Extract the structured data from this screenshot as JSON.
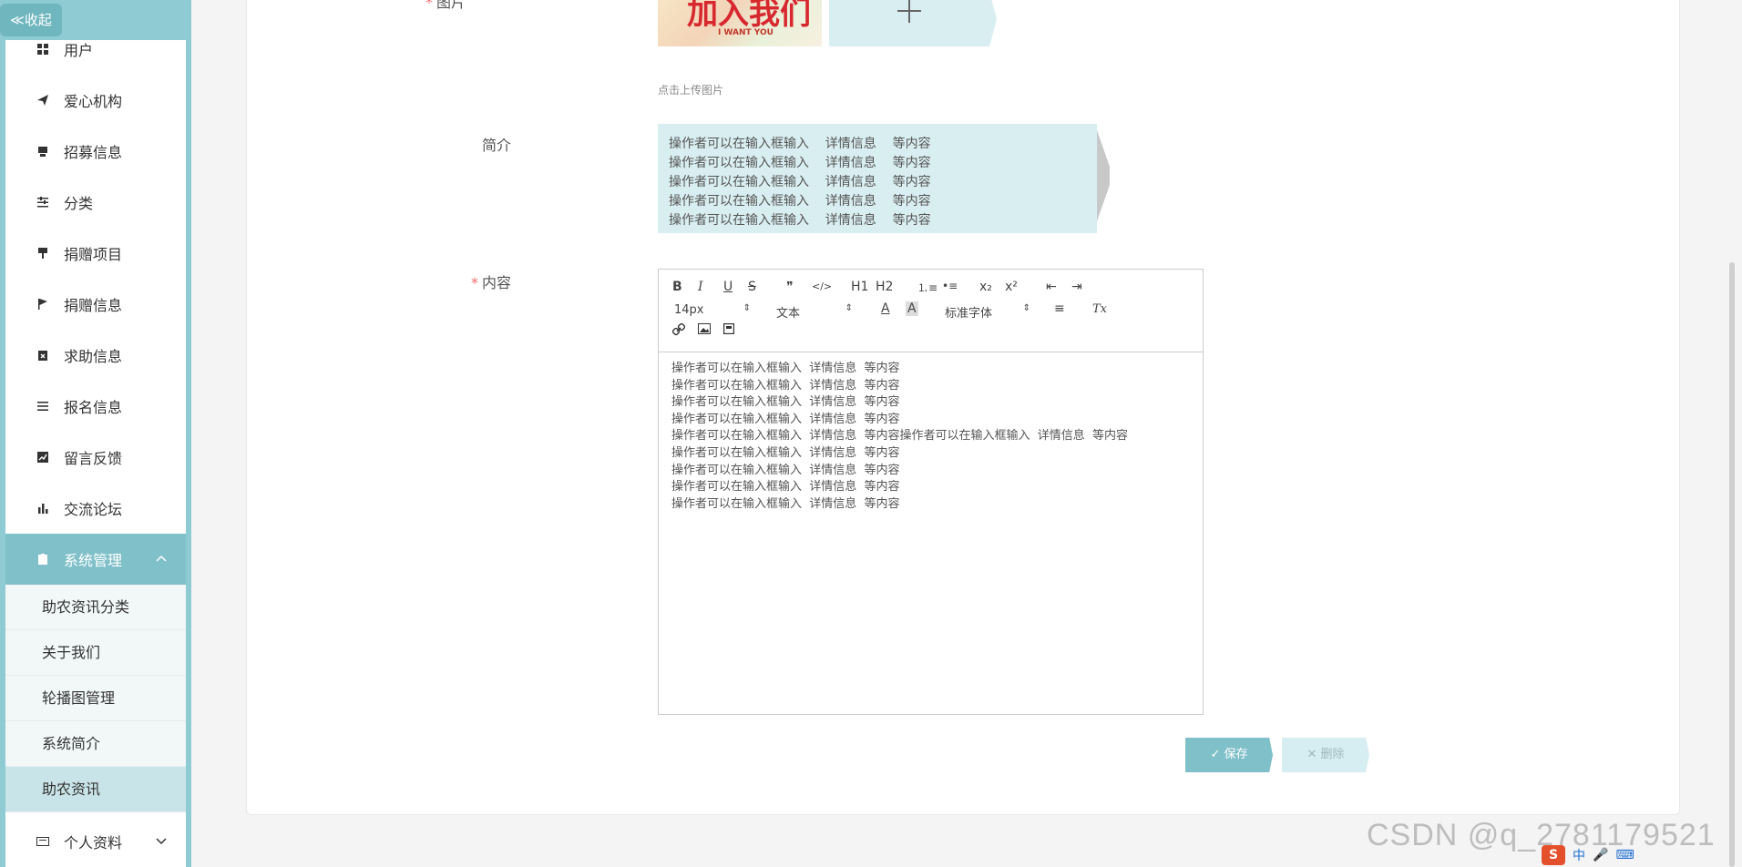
{
  "sidebar": {
    "collapse_label": "≪收起",
    "items": [
      {
        "label": "用户",
        "icon": "grid-icon"
      },
      {
        "label": "爱心机构",
        "icon": "send-icon"
      },
      {
        "label": "招募信息",
        "icon": "printer-icon"
      },
      {
        "label": "分类",
        "icon": "sliders-icon"
      },
      {
        "label": "捐赠项目",
        "icon": "brush-icon"
      },
      {
        "label": "捐赠信息",
        "icon": "flag-icon"
      },
      {
        "label": "求助信息",
        "icon": "clipboard-x-icon"
      },
      {
        "label": "报名信息",
        "icon": "list-icon"
      },
      {
        "label": "留言反馈",
        "icon": "chart-line-icon"
      },
      {
        "label": "交流论坛",
        "icon": "bar-chart-icon"
      },
      {
        "label": "系统管理",
        "icon": "clipboard-icon"
      },
      {
        "label": "个人资料",
        "icon": "id-card-icon"
      }
    ],
    "sub_items": [
      {
        "label": "助农资讯分类"
      },
      {
        "label": "关于我们"
      },
      {
        "label": "轮播图管理"
      },
      {
        "label": "系统简介"
      },
      {
        "label": "助农资讯"
      }
    ],
    "active_group": "系统管理",
    "active_sub": "助农资讯"
  },
  "form": {
    "image_label": "图片",
    "image_thumb_text": "加入我们",
    "image_thumb_sub": "I WANT YOU",
    "upload_hint": "点击上传图片",
    "intro_label": "简介",
    "intro_value": "操作者可以在输入框输入    详情信息    等内容\n操作者可以在输入框输入    详情信息    等内容\n操作者可以在输入框输入    详情信息    等内容\n操作者可以在输入框输入    详情信息    等内容\n操作者可以在输入框输入    详情信息    等内容",
    "content_label": "内容",
    "required_mark": "*",
    "content_value": "操作者可以在输入框输入  详情信息  等内容\n操作者可以在输入框输入  详情信息  等内容\n操作者可以在输入框输入  详情信息  等内容\n操作者可以在输入框输入  详情信息  等内容\n操作者可以在输入框输入  详情信息  等内容操作者可以在输入框输入  详情信息  等内容\n操作者可以在输入框输入  详情信息  等内容\n操作者可以在输入框输入  详情信息  等内容\n操作者可以在输入框输入  详情信息  等内容\n操作者可以在输入框输入  详情信息  等内容",
    "toolbar": {
      "bold": "B",
      "italic": "I",
      "underline": "U",
      "strike": "S",
      "quote": "❞",
      "code": "</>",
      "h1": "H1",
      "h2": "H2",
      "ordered_list": "⒈≡",
      "bullet_list": "•≡",
      "subscript": "x₂",
      "superscript": "x²",
      "outdent": "⇤",
      "indent": "⇥",
      "font_size": "14px",
      "block_type": "文本",
      "font_family": "标准字体",
      "font_color": "A",
      "bg_color": "A",
      "align": "≡",
      "clear_format": "Tx",
      "link": "🔗",
      "image": "▣",
      "video": "▤"
    },
    "save_label": "✓ 保存",
    "delete_label": "✕ 删除"
  },
  "watermark": "CSDN @q_2781179521",
  "ime": {
    "logo": "S",
    "lang": "中"
  }
}
